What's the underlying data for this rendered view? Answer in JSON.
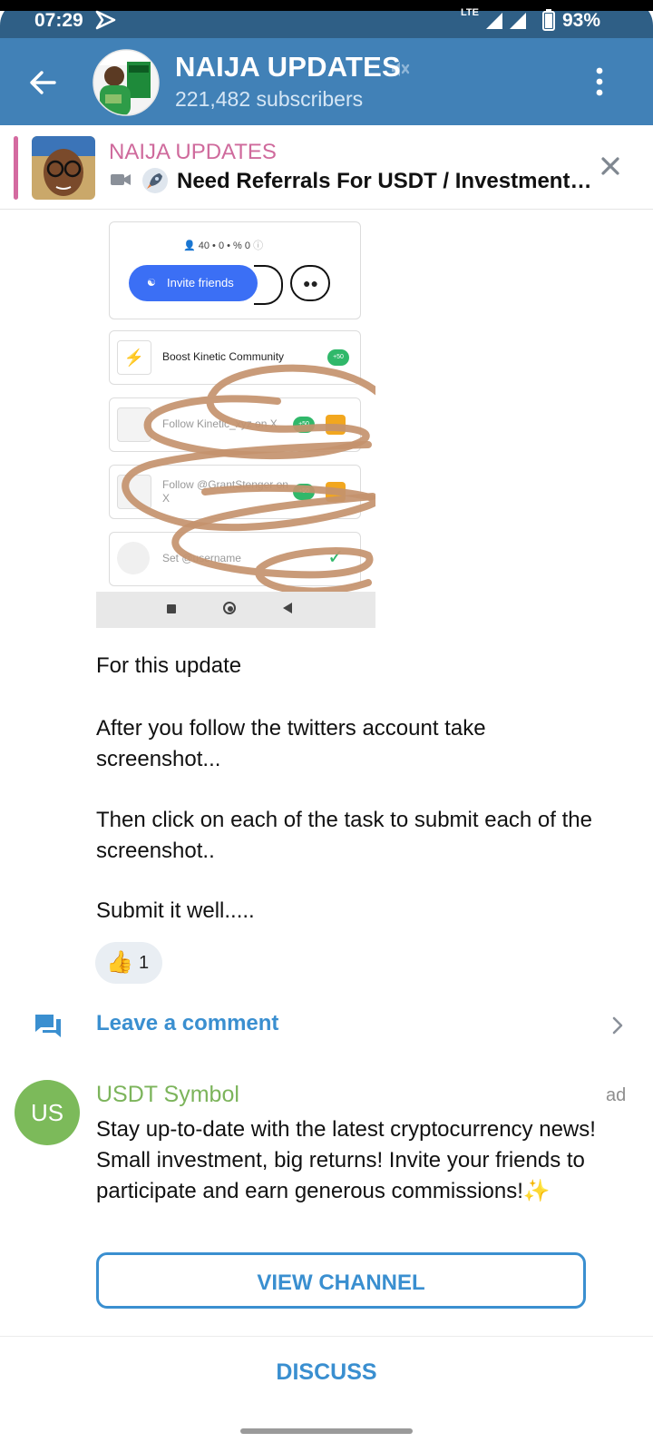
{
  "status_bar": {
    "time": "07:29",
    "network": "LTE",
    "battery": "93%"
  },
  "header": {
    "title": "NAIJA UPDATES",
    "subscribers": "221,482 subscribers"
  },
  "pinned": {
    "title": "NAIJA UPDATES",
    "text": "Need Referrals For USDT / Investment Site"
  },
  "screenshot": {
    "stats": "40 • 0 • % 0",
    "invite_label": "Invite friends",
    "tasks": [
      {
        "label": "Boost Kinetic Community",
        "badge": "+50"
      },
      {
        "label": "Follow Kinetic_xyz on X",
        "badge": "+50"
      },
      {
        "label": "Follow @GrantStenger on X",
        "badge": "+50"
      },
      {
        "label": "Set @username",
        "badge": "✓"
      }
    ]
  },
  "message": {
    "p1": "For this update",
    "p2": "After you follow the twitters account take screenshot...",
    "p3": "Then click on each of the task to submit each of the screenshot..",
    "p4": "Submit it well....."
  },
  "reaction": {
    "emoji": "👍",
    "count": "1"
  },
  "comment": {
    "label": "Leave a comment"
  },
  "ad": {
    "avatar_initials": "US",
    "name": "USDT Symbol",
    "tag": "ad",
    "text": "Stay up-to-date with the latest cryptocurrency news! Small investment, big returns! Invite your friends to participate and earn generous commissions!✨",
    "button": "VIEW CHANNEL"
  },
  "footer": {
    "discuss": "DISCUSS"
  },
  "colors": {
    "header": "#4181b7",
    "link": "#3a8fd0",
    "ad_green": "#7cba5a",
    "pin_pink": "#d46aa0"
  }
}
